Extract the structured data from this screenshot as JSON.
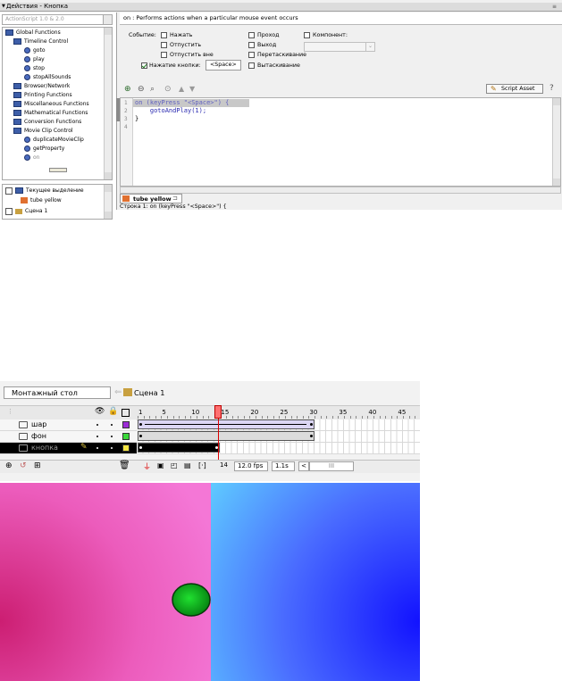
{
  "actions_panel": {
    "title": "Действия - Кнопка",
    "version_select": "ActionScript 1.0 & 2.0",
    "tree_items": [
      {
        "label": "Global Functions",
        "icon": "book-icon"
      },
      {
        "label": "Timeline Control",
        "icon": "book-icon"
      },
      {
        "label": "goto",
        "icon": "function-icon"
      },
      {
        "label": "play",
        "icon": "function-icon"
      },
      {
        "label": "stop",
        "icon": "function-icon"
      },
      {
        "label": "stopAllSounds",
        "icon": "function-icon"
      },
      {
        "label": "Browser/Network",
        "icon": "book-icon"
      },
      {
        "label": "Printing Functions",
        "icon": "book-icon"
      },
      {
        "label": "Miscellaneous Functions",
        "icon": "book-icon"
      },
      {
        "label": "Mathematical Functions",
        "icon": "book-icon"
      },
      {
        "label": "Conversion Functions",
        "icon": "book-icon"
      },
      {
        "label": "Movie Clip Control",
        "icon": "book-icon"
      },
      {
        "label": "duplicateMovieClip",
        "icon": "function-icon"
      },
      {
        "label": "getProperty",
        "icon": "function-icon"
      },
      {
        "label": "on",
        "icon": "function-icon"
      }
    ],
    "selection_tree": [
      {
        "label": "Текущее выделение"
      },
      {
        "label": "tube yellow"
      },
      {
        "label": "Сцена 1"
      }
    ],
    "hint": "on : Performs actions when a particular mouse event occurs",
    "event_label": "Событие:",
    "events": {
      "press": "Нажать",
      "release": "Отпустить",
      "release_outside": "Отпустить вне",
      "key_press": "Нажатие кнопки:",
      "key_value": "<Space>",
      "roll_over": "Проход",
      "roll_out": "Выход",
      "drag_over": "Перетаскивание",
      "drag_out": "Вытаскивание",
      "component": "Компонент:"
    },
    "script_asset": "Script Asset",
    "code_lines": [
      {
        "num": "1",
        "text": "on (keyPress \"<Space>\") {"
      },
      {
        "num": "2",
        "text": "    gotoAndPlay(1);"
      },
      {
        "num": "3",
        "text": "}"
      },
      {
        "num": "4",
        "text": ""
      }
    ],
    "script_tab": "tube yellow",
    "status_line": "Строка 1: on (keyPress \"<Space>\") {"
  },
  "timeline": {
    "stage_tab": "Монтажный стол",
    "scene": "Сцена 1",
    "frame_numbers": [
      "1",
      "5",
      "10",
      "15",
      "20",
      "25",
      "30",
      "35",
      "40",
      "45"
    ],
    "layers": [
      {
        "name": "шар",
        "color": "#9c2cd6",
        "selected": false
      },
      {
        "name": "фон",
        "color": "#3bd93b",
        "selected": false
      },
      {
        "name": "кнопка",
        "color": "#f5e642",
        "selected": true
      }
    ],
    "current_frame": "14",
    "fps": "12.0 fps",
    "time": "1.1s"
  },
  "colors": {
    "stage_left_magenta": "#e0389c",
    "stage_right_blue": "#3a3aff",
    "ball_green": "#0fbf1f"
  }
}
